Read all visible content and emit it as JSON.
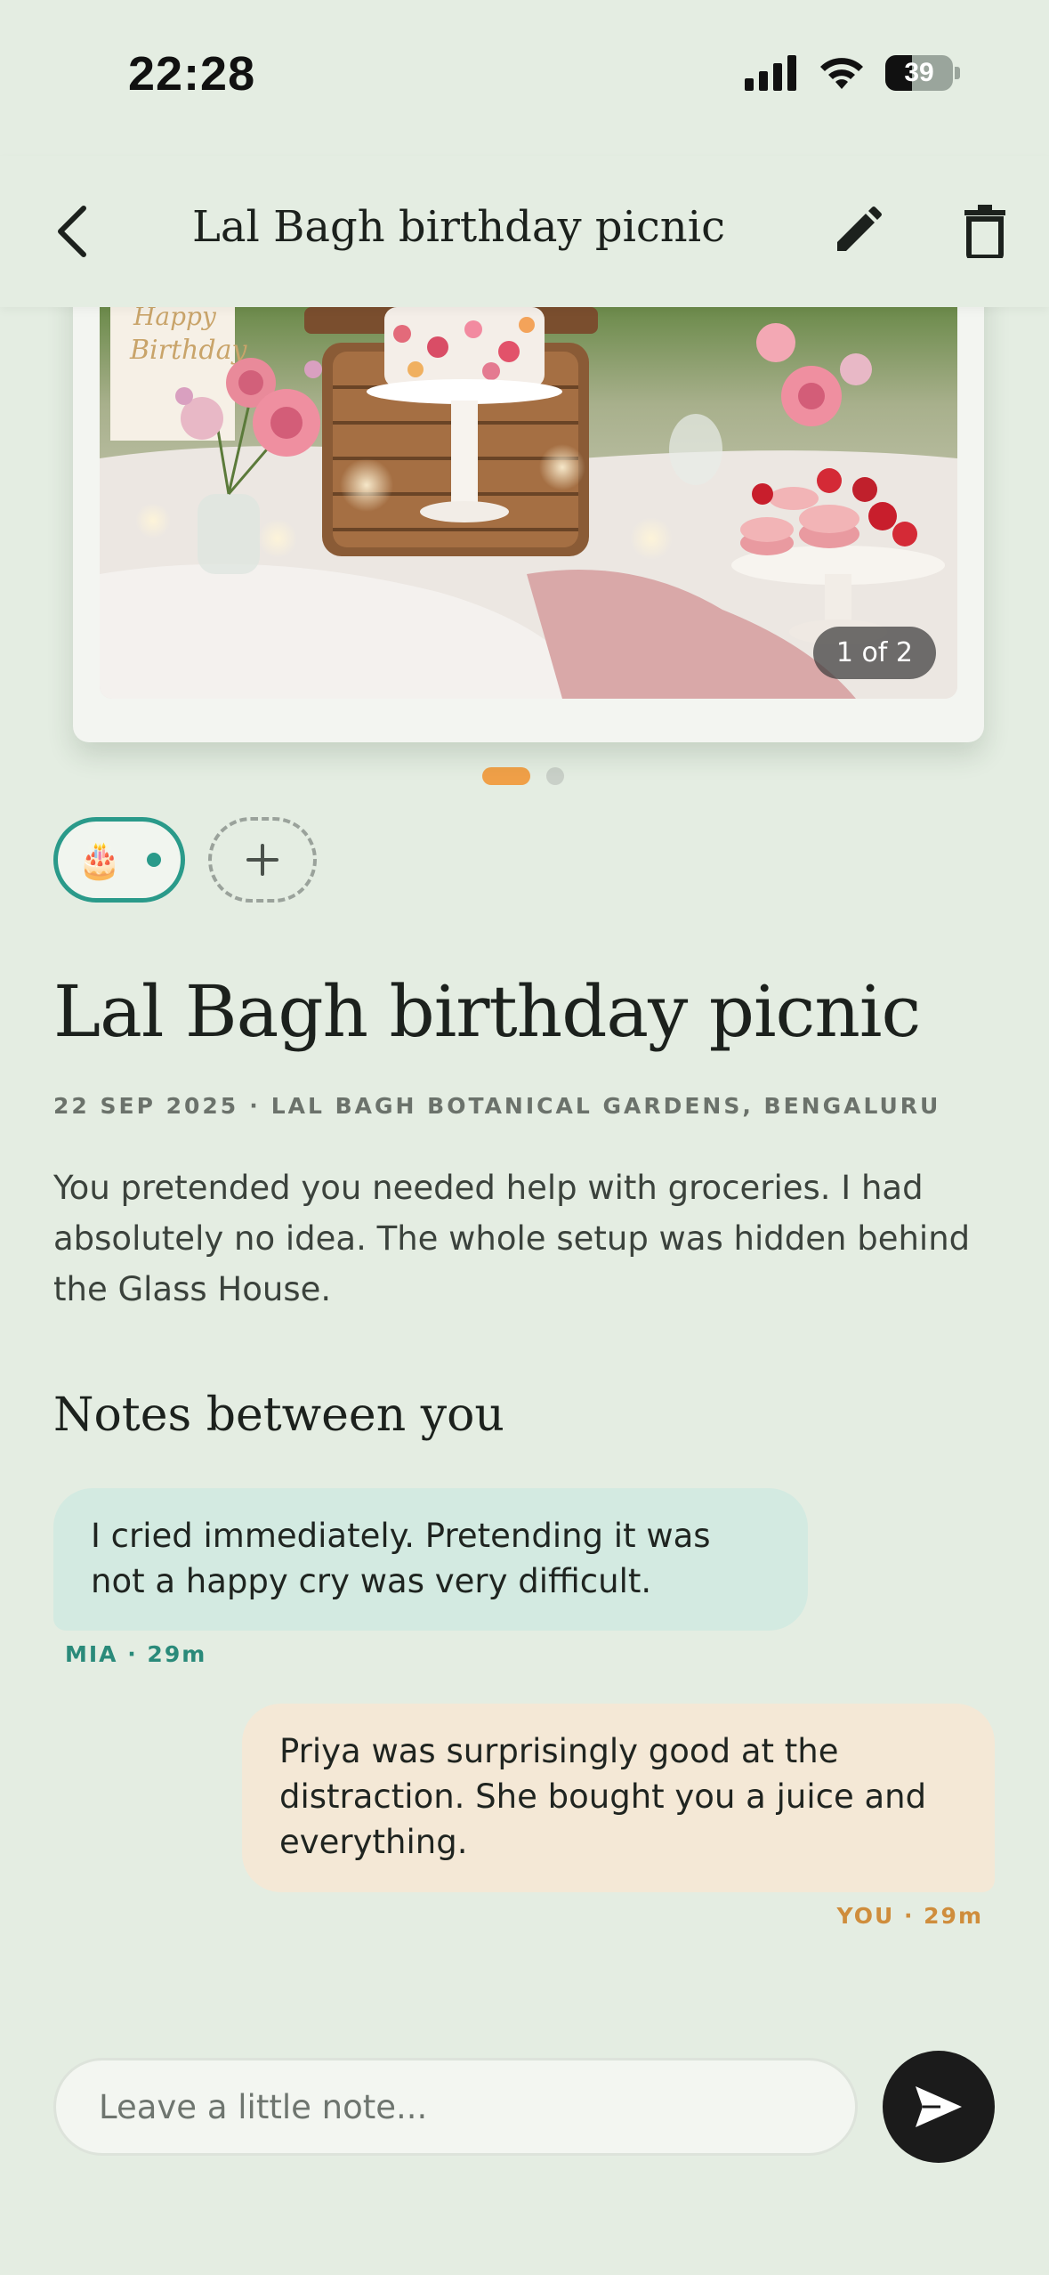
{
  "status_bar": {
    "time": "22:28",
    "battery_level": "39"
  },
  "header": {
    "title": "Lal Bagh birthday picnic",
    "back_icon": "chevron-left-icon",
    "edit_icon": "pencil-icon",
    "delete_icon": "trash-icon"
  },
  "photo": {
    "sign_text": "Happy Birthday",
    "counter": "1 of 2",
    "current_index": 1,
    "total": 2
  },
  "reactions": {
    "selected_emoji": "🎂",
    "add_icon": "plus-icon"
  },
  "memory": {
    "title": "Lal Bagh birthday picnic",
    "date": "22 SEP 2025",
    "separator": "·",
    "location": "LAL BAGH BOTANICAL GARDENS, BENGALURU",
    "description": "You pretended you needed help with groceries. I had absolutely no idea. The whole setup was hidden behind the Glass House."
  },
  "notes": {
    "heading": "Notes between you",
    "items": [
      {
        "text": "I cried immediately. Pretending it was not a happy cry was very difficult.",
        "meta": "MIA · 29m"
      },
      {
        "text": "Priya was surprisingly good at the distraction. She bought you a juice and everything.",
        "meta": "YOU · 29m"
      }
    ]
  },
  "composer": {
    "placeholder": "Leave a little note...",
    "value": "",
    "send_icon": "send-icon"
  },
  "colors": {
    "background": "#e4ede2",
    "mia_bubble": "#d3eae1",
    "you_bubble": "#f4e8d6",
    "mia_accent": "#2a8a7a",
    "you_accent": "#cf8d3c",
    "active_dot": "#f0a048"
  }
}
